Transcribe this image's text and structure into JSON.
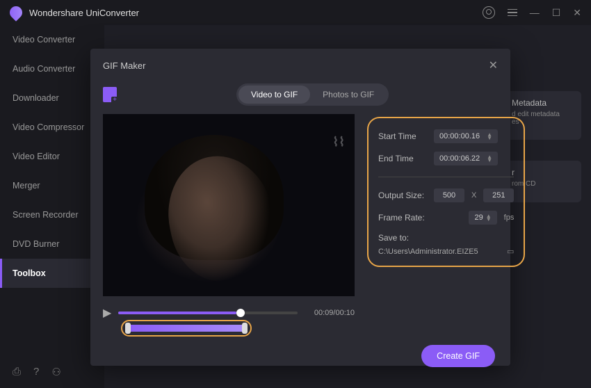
{
  "app": {
    "title": "Wondershare UniConverter"
  },
  "sidebar": {
    "items": [
      {
        "label": "Video Converter"
      },
      {
        "label": "Audio Converter"
      },
      {
        "label": "Downloader"
      },
      {
        "label": "Video Compressor"
      },
      {
        "label": "Video Editor"
      },
      {
        "label": "Merger"
      },
      {
        "label": "Screen Recorder"
      },
      {
        "label": "DVD Burner"
      },
      {
        "label": "Toolbox"
      }
    ]
  },
  "bgcards": {
    "metadata_title": "Metadata",
    "metadata_desc": "d edit metadata",
    "cd_title": "r",
    "cd_desc": "rom CD"
  },
  "modal": {
    "title": "GIF Maker",
    "tabs": {
      "video": "Video to GIF",
      "photos": "Photos to GIF"
    },
    "watermark": "⌇⌇",
    "player": {
      "time": "00:09/00:10"
    },
    "settings": {
      "start_label": "Start Time",
      "start_value": "00:00:00.16",
      "end_label": "End Time",
      "end_value": "00:00:06.22",
      "output_label": "Output Size:",
      "width": "500",
      "height": "251",
      "x": "X",
      "framerate_label": "Frame Rate:",
      "framerate": "29",
      "fps": "fps",
      "save_label": "Save to:",
      "save_path": "C:\\Users\\Administrator.EIZE5"
    },
    "create": "Create GIF"
  }
}
